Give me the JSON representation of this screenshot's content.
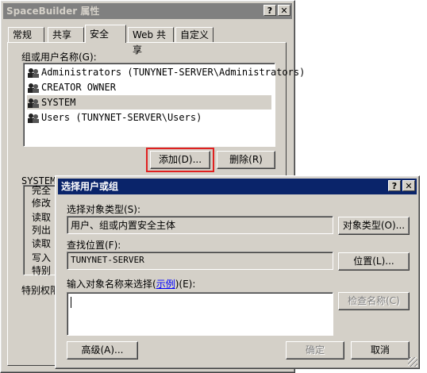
{
  "back_window": {
    "title": "SpaceBuilder 属性",
    "tabs": [
      "常规",
      "共享",
      "安全",
      "Web 共享",
      "自定义"
    ],
    "active_tab": "安全",
    "group_label": "组或用户名称(G):",
    "users": [
      "Administrators (TUNYNET-SERVER\\Administrators)",
      "CREATOR OWNER",
      "SYSTEM",
      "Users (TUNYNET-SERVER\\Users)"
    ],
    "selected_user": "SYSTEM",
    "add_button": "添加(D)...",
    "remove_button": "删除(R)",
    "perm_header": "SYSTEM",
    "permissions": [
      "完全",
      "修改",
      "读取",
      "列出",
      "读取",
      "写入",
      "特别"
    ],
    "special_label": "特别权限"
  },
  "front_dialog": {
    "title": "选择用户或组",
    "object_type_label": "选择对象类型(S):",
    "object_type_value": "用户、组或内置安全主体",
    "object_type_button": "对象类型(O)...",
    "location_label": "查找位置(F):",
    "location_value": "TUNYNET-SERVER",
    "location_button": "位置(L)...",
    "input_label_prefix": "输入对象名称来选择(",
    "input_label_link": "示例",
    "input_label_suffix": ")(E):",
    "check_names_button": "检查名称(C)",
    "advanced_button": "高级(A)...",
    "ok_button": "确定",
    "cancel_button": "取消"
  },
  "titlebar_buttons": {
    "help": "?",
    "close": "✕"
  },
  "colors": {
    "highlight_box": "#e02020",
    "active_title": "#0a246a",
    "link": "#0000ff"
  }
}
